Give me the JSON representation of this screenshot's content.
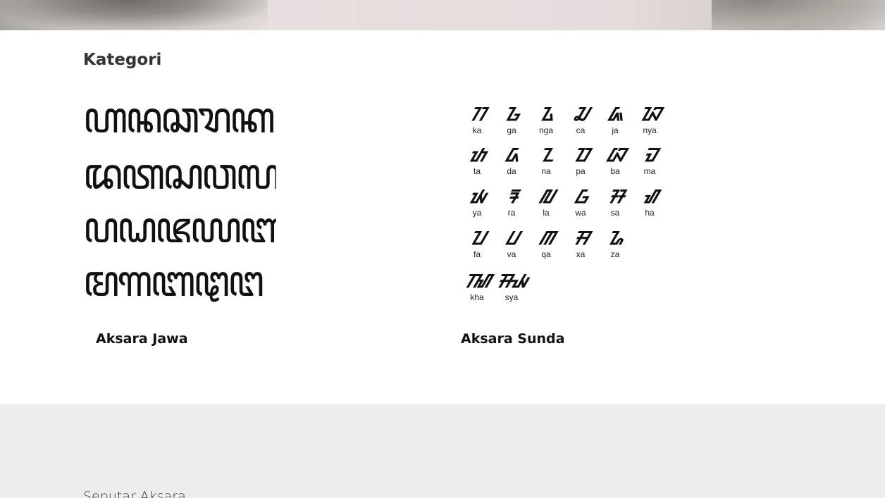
{
  "section": {
    "title": "Kategori"
  },
  "cards": [
    {
      "label": "Aksara Jawa",
      "glyph_rows": [
        "ꦲꦤꦕꦫꦏ",
        "ꦢꦠꦱꦮꦭ",
        "ꦥꦝꦗꦪꦚ",
        "ꦩꦒꦧꦛꦔ"
      ]
    },
    {
      "label": "Aksara Sunda",
      "rows": [
        [
          {
            "glyph": "ᮊ",
            "latin": "ka"
          },
          {
            "glyph": "ᮌ",
            "latin": "ga"
          },
          {
            "glyph": "ᮍ",
            "latin": "nga"
          },
          {
            "glyph": "ᮎ",
            "latin": "ca"
          },
          {
            "glyph": "ᮏ",
            "latin": "ja"
          },
          {
            "glyph": "ᮑ",
            "latin": "nya"
          }
        ],
        [
          {
            "glyph": "ᮒ",
            "latin": "ta"
          },
          {
            "glyph": "ᮓ",
            "latin": "da"
          },
          {
            "glyph": "ᮔ",
            "latin": "na"
          },
          {
            "glyph": "ᮕ",
            "latin": "pa"
          },
          {
            "glyph": "ᮘ",
            "latin": "ba"
          },
          {
            "glyph": "ᮙ",
            "latin": "ma"
          }
        ],
        [
          {
            "glyph": "ᮚ",
            "latin": "ya"
          },
          {
            "glyph": "ᮛ",
            "latin": "ra"
          },
          {
            "glyph": "ᮜ",
            "latin": "la"
          },
          {
            "glyph": "ᮝ",
            "latin": "wa"
          },
          {
            "glyph": "ᮞ",
            "latin": "sa"
          },
          {
            "glyph": "ᮠ",
            "latin": "ha"
          }
        ],
        [
          {
            "glyph": "ᮖ",
            "latin": "fa"
          },
          {
            "glyph": "ᮗ",
            "latin": "va"
          },
          {
            "glyph": "ᮋ",
            "latin": "qa"
          },
          {
            "glyph": "ᮟ",
            "latin": "xa"
          },
          {
            "glyph": "ᮐ",
            "latin": "za"
          }
        ],
        [
          {
            "glyph": "ᮮ",
            "latin": "kha"
          },
          {
            "glyph": "ᮯ",
            "latin": "sya"
          }
        ]
      ]
    }
  ],
  "footer": {
    "text": "Seputar Aksara"
  }
}
